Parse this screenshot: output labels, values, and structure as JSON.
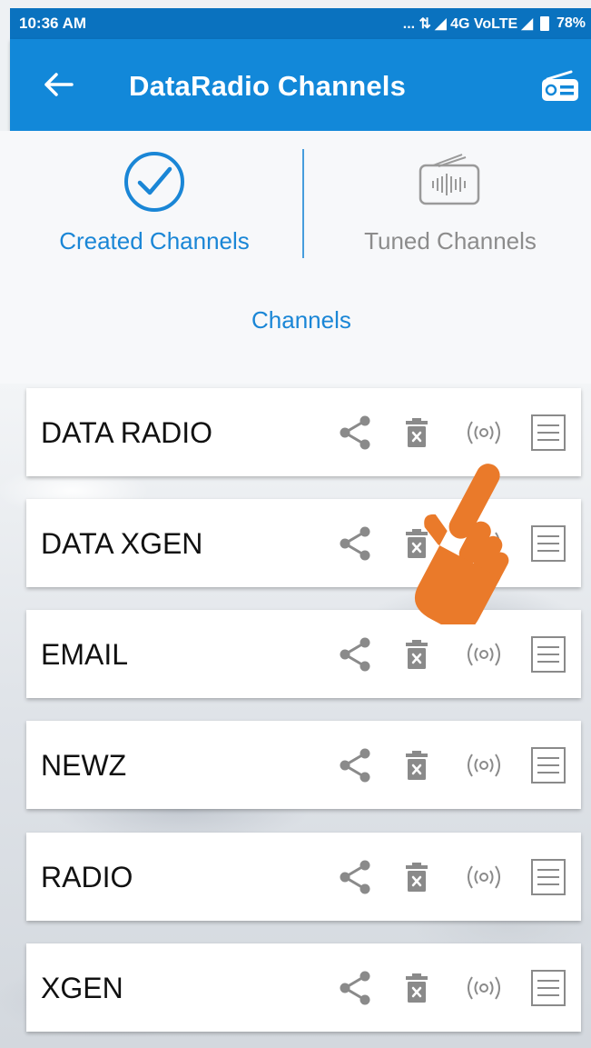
{
  "status_bar": {
    "time": "10:36 AM",
    "network": "... ⇅ ◢ 4G VoLTE ◢",
    "battery": "78%"
  },
  "app_bar": {
    "title": "DataRadio Channels",
    "back_icon": "back-arrow-icon",
    "action_icon": "radio-icon"
  },
  "tabs": {
    "created": "Created Channels",
    "tuned": "Tuned Channels",
    "active": "created"
  },
  "section_label": "Channels",
  "channels": [
    {
      "name": "DATA RADIO"
    },
    {
      "name": "DATA XGEN"
    },
    {
      "name": "EMAIL"
    },
    {
      "name": "NEWZ"
    },
    {
      "name": "RADIO"
    },
    {
      "name": "XGEN"
    }
  ],
  "colors": {
    "primary": "#1288d9",
    "status": "#0a72bf",
    "accent": "#1a86d6",
    "hand": "#ea7a2a"
  }
}
